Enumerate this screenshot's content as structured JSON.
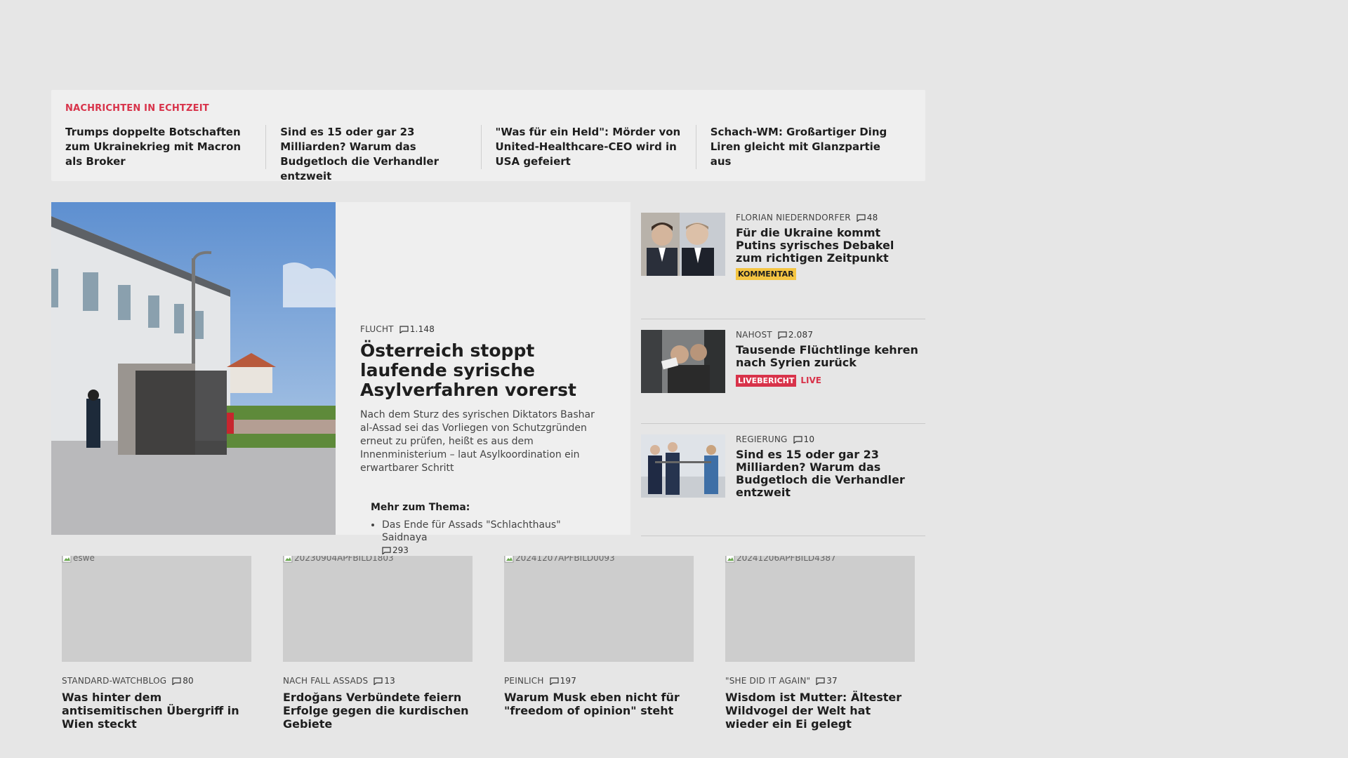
{
  "ticker": {
    "title": "NACHRICHTEN IN ECHTZEIT",
    "items": [
      "Trumps doppelte Botschaften zum Ukrainekrieg mit Macron als Broker",
      "Sind es 15 oder gar 23 Milliarden? Warum das Budgetloch die Verhand­ler entzweit",
      "\"Was für ein Held\": Mörder von United-Healthcare-CEO wird in USA gefeiert",
      "Schach-WM: Großartiger Ding Liren gleicht mit Glanzpartie aus"
    ]
  },
  "lead": {
    "kicker": "FLUCHT",
    "comments": "1.148",
    "title": "Österreich stoppt laufende syrische Asylverfahren vorerst",
    "teaser": "Nach dem Sturz des syrischen Diktators Bashar al-Assad sei das Vorliegen von Schutzgründen erneut zu prüfen, heißt es aus dem Innenministerium – laut Asylkoordination ein erwartbarer Schritt",
    "more_title": "Mehr zum Thema:",
    "more_items": [
      {
        "label": "Das Ende für Assads \"Schlachthaus\" Saidnaya",
        "comments": "293"
      }
    ]
  },
  "side": [
    {
      "kicker": "FLORIAN NIEDERNDORFER",
      "comments": "48",
      "title": "Für die Ukraine kommt Putins syrisches Debakel zum richtigen Zeitpunkt",
      "badge": "KOMMENTAR"
    },
    {
      "kicker": "NAHOST",
      "comments": "2.087",
      "title": "Tausende Flüchtlinge kehren nach Syrien zurück",
      "badge": "LIVEBERICHT",
      "live": "LIVE"
    },
    {
      "kicker": "REGIERUNG",
      "comments": "10",
      "title": "Sind es 15 oder gar 23 Milliarden? Warum das Budgetloch die Verhandler entzweit"
    }
  ],
  "cards": [
    {
      "alt": "eswe",
      "kicker": "STANDARD-WATCHBLOG",
      "comments": "80",
      "title": "Was hinter dem antisemitischen Übergriff in Wien steckt"
    },
    {
      "alt": "20230904APFBILD1803",
      "kicker": "NACH FALL ASSADS",
      "comments": "13",
      "title": "Erdoğans Verbündete feiern Erfolge gegen die kurdischen Gebiete"
    },
    {
      "alt": "20241207APFBILD0093",
      "kicker": "PEINLICH",
      "comments": "197",
      "title": "Warum Musk eben nicht für \"freedom of opinion\" steht"
    },
    {
      "alt": "20241206APFBILD4387",
      "kicker": "\"SHE DID IT AGAIN\"",
      "comments": "37",
      "title": "Wisdom ist Mutter: Ältester Wildvogel der Welt hat wieder ein Ei gelegt"
    }
  ],
  "colors": {
    "accent": "#d8334a",
    "badge_yellow": "#f4c543",
    "background": "#e6e6e6",
    "panel": "#efefef"
  },
  "icons": {
    "comment": "comment-bubble-icon",
    "broken_image": "broken-image-icon"
  }
}
